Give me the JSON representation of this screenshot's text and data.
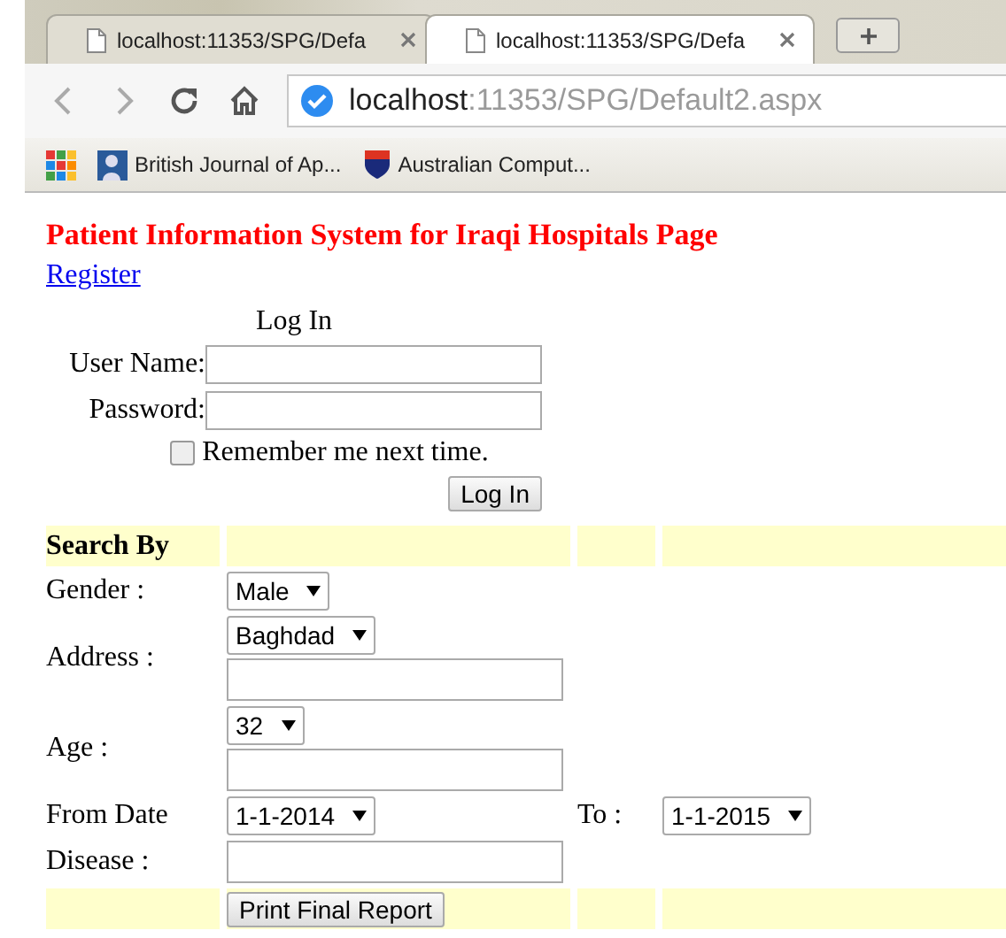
{
  "tabs": [
    {
      "title": "localhost:11353/SPG/Defa",
      "selected": false
    },
    {
      "title": "localhost:11353/SPG/Defa",
      "selected": true
    }
  ],
  "address": {
    "host": "localhost",
    "path": ":11353/SPG/Default2.aspx"
  },
  "bookmarks": [
    {
      "label": "British Journal of Ap..."
    },
    {
      "label": "Australian Comput..."
    }
  ],
  "page": {
    "title": "Patient Information System for Iraqi Hospitals Page",
    "register_link": "Register",
    "login": {
      "heading": "Log In",
      "user_label": "User Name:",
      "password_label": "Password:",
      "remember_label": "Remember me next time.",
      "remember_checked": false,
      "button": "Log In"
    },
    "search": {
      "heading": "Search By",
      "rows": [
        {
          "label": "Gender :",
          "fields": [
            {
              "kind": "select",
              "value": "Male"
            }
          ]
        },
        {
          "label": "Address :",
          "fields": [
            {
              "kind": "select",
              "value": "Baghdad"
            },
            {
              "kind": "text"
            }
          ]
        },
        {
          "label": "Age :",
          "fields": [
            {
              "kind": "select",
              "value": "32"
            },
            {
              "kind": "text"
            }
          ]
        },
        {
          "label": "From Date",
          "fields": [
            {
              "kind": "select",
              "value": "1-1-2014"
            }
          ],
          "to_label": "To :",
          "to_field": {
            "kind": "select",
            "value": "1-1-2015"
          }
        },
        {
          "label": "Disease :",
          "fields": [
            {
              "kind": "text"
            }
          ]
        }
      ],
      "button": "Print Final Report"
    }
  }
}
